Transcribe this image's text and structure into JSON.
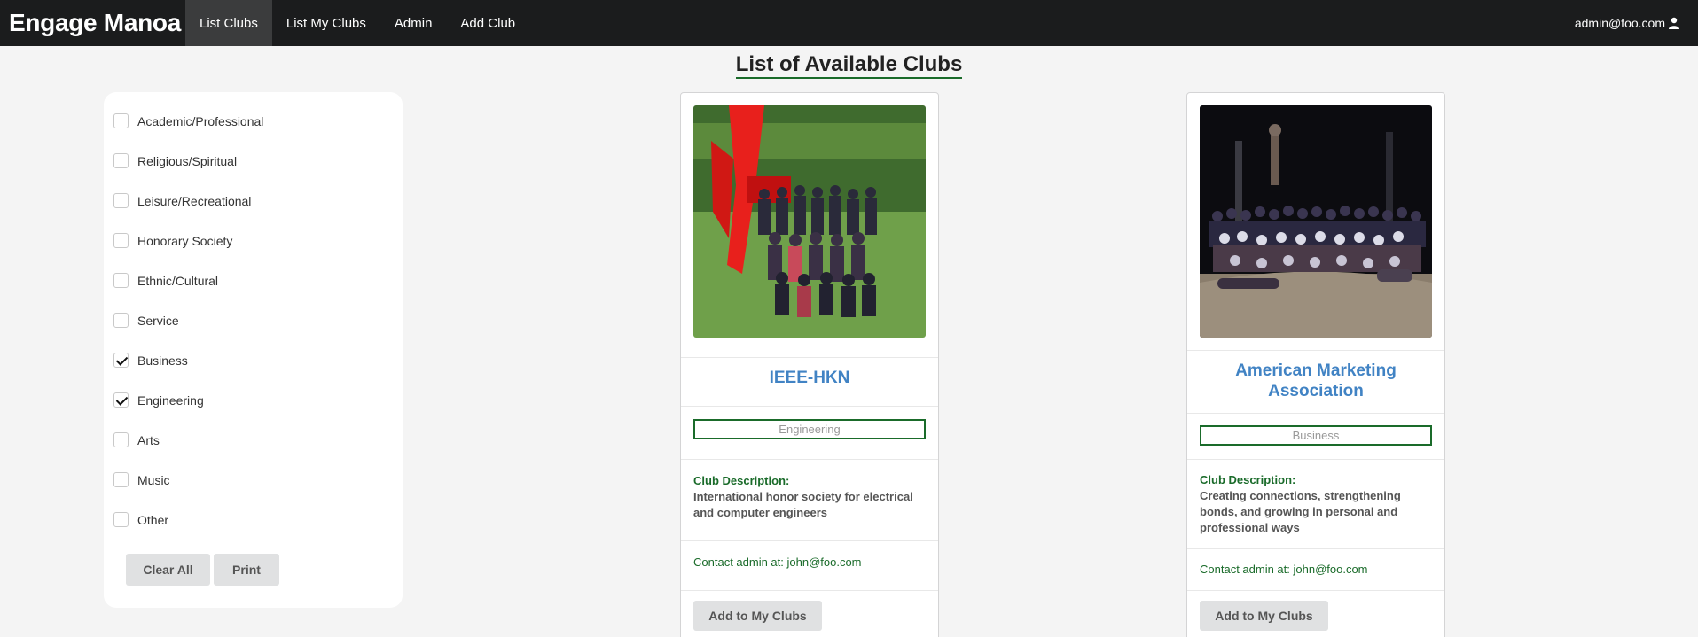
{
  "navbar": {
    "brand": "Engage Manoa",
    "items": [
      {
        "label": "List Clubs",
        "active": true
      },
      {
        "label": "List My Clubs",
        "active": false
      },
      {
        "label": "Admin",
        "active": false
      },
      {
        "label": "Add Club",
        "active": false
      }
    ],
    "user": "admin@foo.com",
    "user_icon": "user-icon"
  },
  "page_title": "List of Available Clubs",
  "filters": {
    "items": [
      {
        "label": "Academic/Professional",
        "checked": false
      },
      {
        "label": "Religious/Spiritual",
        "checked": false
      },
      {
        "label": "Leisure/Recreational",
        "checked": false
      },
      {
        "label": "Honorary Society",
        "checked": false
      },
      {
        "label": "Ethnic/Cultural",
        "checked": false
      },
      {
        "label": "Service",
        "checked": false
      },
      {
        "label": "Business",
        "checked": true
      },
      {
        "label": "Engineering",
        "checked": true
      },
      {
        "label": "Arts",
        "checked": false
      },
      {
        "label": "Music",
        "checked": false
      },
      {
        "label": "Other",
        "checked": false
      }
    ],
    "clear_label": "Clear All",
    "print_label": "Print"
  },
  "clubs": [
    {
      "name": "IEEE-HKN",
      "tag": "Engineering",
      "desc_label": "Club Description:",
      "description": "International honor society for electrical and computer engineers",
      "contact": "Contact admin at: john@foo.com",
      "button_label": "Add to My Clubs"
    },
    {
      "name": "American Marketing Association",
      "tag": "Business",
      "desc_label": "Club Description:",
      "description": "Creating connections, strengthening bonds, and growing in personal and professional ways",
      "contact": "Contact admin at: john@foo.com",
      "button_label": "Add to My Clubs"
    }
  ],
  "colors": {
    "navbar": "#1b1c1d",
    "accent_green": "#1a6b2a",
    "link_blue": "#4183c4"
  }
}
